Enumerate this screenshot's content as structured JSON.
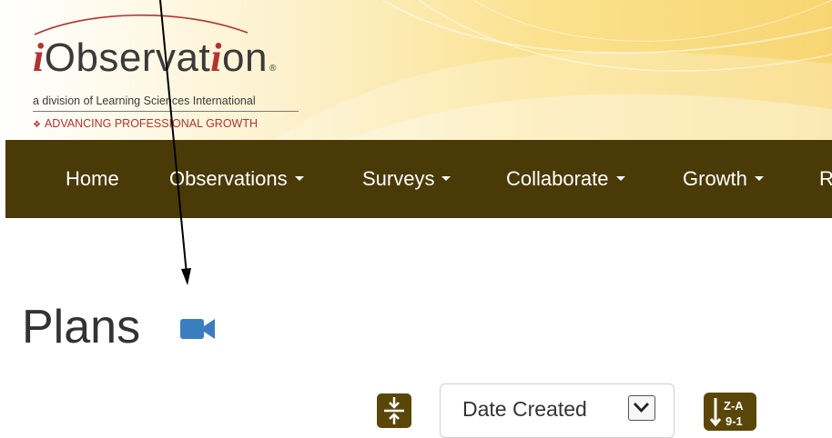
{
  "logo": {
    "brand_i1": "i",
    "brand_mid1": "Observat",
    "brand_i2": "i",
    "brand_mid2": "on",
    "registered": "®",
    "subtitle": "a division of Learning Sciences International",
    "tagline_dots": "❖",
    "tagline": "ADVANCING PROFESSIONAL GROWTH"
  },
  "nav": {
    "items": [
      {
        "label": "Home"
      },
      {
        "label": "Observations"
      },
      {
        "label": "Surveys"
      },
      {
        "label": "Collaborate"
      },
      {
        "label": "Growth"
      },
      {
        "label": "R"
      }
    ]
  },
  "page": {
    "title": "Plans"
  },
  "controls": {
    "sort_select": {
      "value": "Date Created"
    },
    "sort_order_label_top": "Z-A",
    "sort_order_label_bottom": "9-1"
  },
  "icons": {
    "title_icon": "video-camera-icon",
    "collapse_icon": "collapse-vertical-icon",
    "sort_icon": "sort-desc-alpha-num-icon",
    "select_icon": "chevron-down-icon",
    "annotation": "annotation-arrow"
  },
  "colors": {
    "nav_bg": "#4a3a07",
    "button_bg": "#5a4608",
    "video_icon": "#3a7ec0",
    "brand_red": "#b5322f"
  }
}
